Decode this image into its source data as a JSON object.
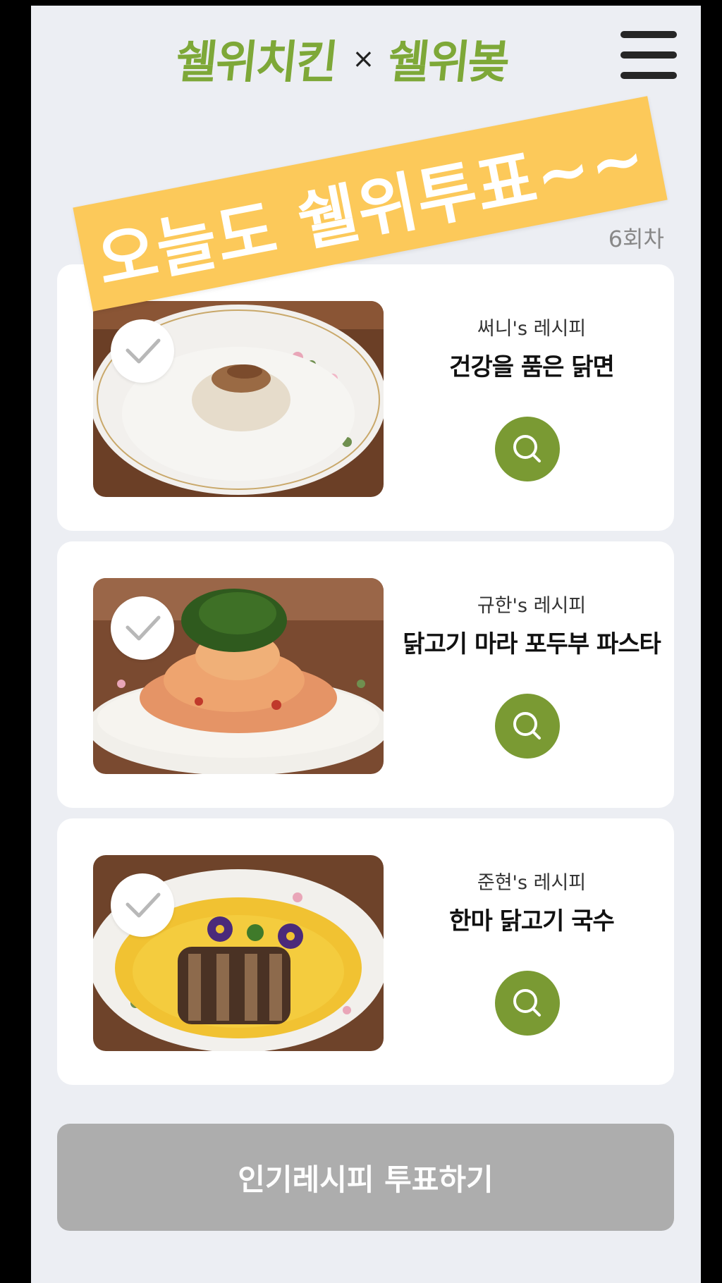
{
  "header": {
    "brand_left": "쉘위치킨",
    "brand_separator": "×",
    "brand_right": "쉘위봊",
    "menu_icon": "hamburger-menu-icon"
  },
  "banner": {
    "text": "오늘도 쉘위투표~~"
  },
  "round_label": "6회차",
  "recipes": [
    {
      "author": "써니's 레시피",
      "title": "건강을 품은 닭면",
      "dish": "white broth chicken noodle"
    },
    {
      "author": "규한's 레시피",
      "title": "닭고기 마라 포두부 파스타",
      "dish": "tofu-skin pasta with herbs"
    },
    {
      "author": "준현's 레시피",
      "title": "한마 닭고기 국수",
      "dish": "grilled chicken in yellow sauce"
    }
  ],
  "vote_button": "인기레시피 투표하기",
  "colors": {
    "brand_green": "#7ea838",
    "search_button": "#7a9a33",
    "sticker": "#fcc95a",
    "vote_button_disabled": "#adadad",
    "background": "#eceef3"
  },
  "icons": {
    "check": "check-icon",
    "search": "search-icon"
  }
}
